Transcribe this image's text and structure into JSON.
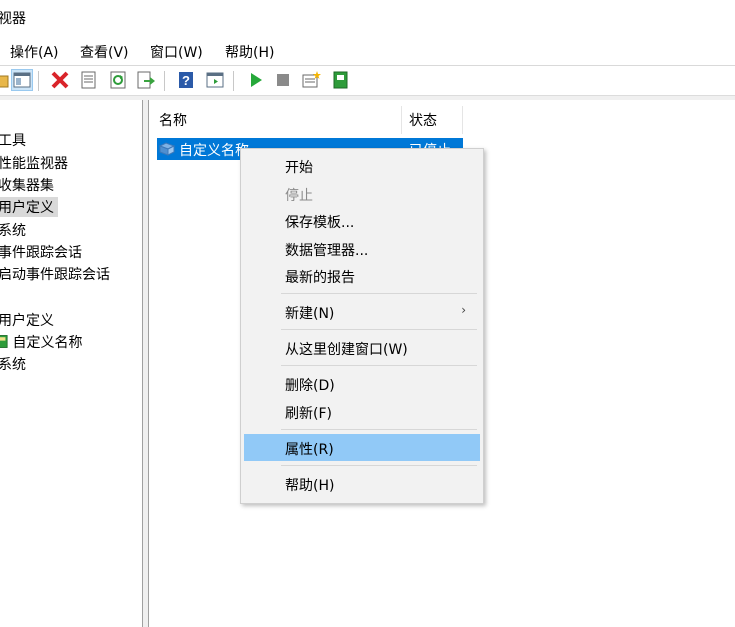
{
  "window": {
    "title": "视器"
  },
  "menubar": {
    "items": [
      {
        "label": "操作(A)"
      },
      {
        "label": "查看(V)"
      },
      {
        "label": "窗口(W)"
      },
      {
        "label": "帮助(H)"
      }
    ]
  },
  "toolbar": {
    "icons": [
      "folder-icon",
      "show-hide-pane-icon",
      "delete-icon",
      "properties-icon",
      "refresh-icon",
      "export-icon",
      "help-icon",
      "console-icon",
      "start-icon",
      "stop-icon",
      "new-collector-icon",
      "book-icon"
    ]
  },
  "tree": {
    "items": [
      {
        "label": "工具"
      },
      {
        "label": "性能监视器"
      },
      {
        "label": "收集器集"
      },
      {
        "label": "用户定义"
      },
      {
        "label": "系统"
      },
      {
        "label": "事件跟踪会话"
      },
      {
        "label": "启动事件跟踪会话"
      },
      {
        "label": "用户定义"
      },
      {
        "label": "自定义名称"
      },
      {
        "label": "系统"
      }
    ]
  },
  "list": {
    "columns": [
      {
        "label": "名称"
      },
      {
        "label": "状态"
      }
    ],
    "rows": [
      {
        "name": "自定义名称",
        "status": "已停止"
      }
    ]
  },
  "context_menu": {
    "items": [
      {
        "label": "开始"
      },
      {
        "label": "停止"
      },
      {
        "label": "保存模板..."
      },
      {
        "label": "数据管理器..."
      },
      {
        "label": "最新的报告"
      },
      {
        "label": "新建(N)"
      },
      {
        "label": "从这里创建窗口(W)"
      },
      {
        "label": "删除(D)"
      },
      {
        "label": "刷新(F)"
      },
      {
        "label": "属性(R)"
      },
      {
        "label": "帮助(H)"
      }
    ],
    "submenu_arrow": "›"
  },
  "colors": {
    "selection": "#0078d7",
    "menu_highlight": "#91c9f7",
    "disabled_text": "#8a8a8a"
  }
}
